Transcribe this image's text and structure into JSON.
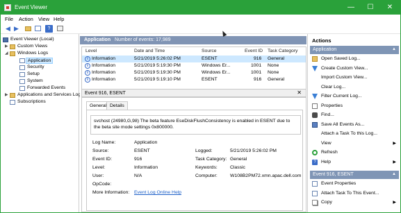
{
  "window": {
    "title": "Event Viewer",
    "controls": {
      "minimize": "—",
      "maximize": "☐",
      "close": "✕"
    }
  },
  "menu": [
    "File",
    "Action",
    "View",
    "Help"
  ],
  "tree": {
    "root": "Event Viewer (Local)",
    "custom_views": "Custom Views",
    "windows_logs": "Windows Logs",
    "logs": [
      "Application",
      "Security",
      "Setup",
      "System",
      "Forwarded Events"
    ],
    "apps_services": "Applications and Services Log",
    "subscriptions": "Subscriptions"
  },
  "log_header": {
    "name": "Application",
    "count_text": "Number of events: 17,989"
  },
  "grid": {
    "columns": [
      "Level",
      "Date and Time",
      "Source",
      "Event ID",
      "Task Category"
    ],
    "rows": [
      {
        "level": "Information",
        "date": "5/21/2019 5:26:02 PM",
        "source": "ESENT",
        "id": "916",
        "category": "General"
      },
      {
        "level": "Information",
        "date": "5/21/2019 5:19:30 PM",
        "source": "Windows Er...",
        "id": "1001",
        "category": "None"
      },
      {
        "level": "Information",
        "date": "5/21/2019 5:19:30 PM",
        "source": "Windows Er...",
        "id": "1001",
        "category": "None"
      },
      {
        "level": "Information",
        "date": "5/21/2019 5:19:10 PM",
        "source": "ESENT",
        "id": "916",
        "category": "General"
      }
    ]
  },
  "detail": {
    "header": "Event 916, ESENT",
    "close": "✕",
    "tabs": [
      "General",
      "Details"
    ],
    "description": "svchost (24980,G,98) The beta feature EseDiskFlushConsistency is enabled in ESENT due to the beta site mode settings 0x800000.",
    "fields": {
      "log_name_label": "Log Name:",
      "log_name": "Application",
      "source_label": "Source:",
      "source": "ESENT",
      "event_id_label": "Event ID:",
      "event_id": "916",
      "level_label": "Level:",
      "level": "Information",
      "user_label": "User:",
      "user": "N/A",
      "opcode_label": "OpCode:",
      "opcode": "",
      "more_info_label": "More Information:",
      "more_info_link": "Event Log Online Help",
      "logged_label": "Logged:",
      "logged": "5/21/2019 5:26:02 PM",
      "task_category_label": "Task Category:",
      "task_category": "General",
      "keywords_label": "Keywords:",
      "keywords": "Classic",
      "computer_label": "Computer:",
      "computer": "W108B2PM72.xmn.apac.dell.com"
    }
  },
  "actions": {
    "title": "Actions",
    "section1": "Application",
    "items1": [
      {
        "label": "Open Saved Log...",
        "icon": "folder",
        "arrow": ""
      },
      {
        "label": "Create Custom View...",
        "icon": "funnel",
        "arrow": ""
      },
      {
        "label": "Import Custom View...",
        "icon": "none",
        "arrow": ""
      },
      {
        "label": "Clear Log...",
        "icon": "none",
        "arrow": ""
      },
      {
        "label": "Filter Current Log...",
        "icon": "funnel",
        "arrow": ""
      },
      {
        "label": "Properties",
        "icon": "props",
        "arrow": ""
      },
      {
        "label": "Find...",
        "icon": "bino",
        "arrow": ""
      },
      {
        "label": "Save All Events As...",
        "icon": "save",
        "arrow": ""
      },
      {
        "label": "Attach a Task To this Log...",
        "icon": "none",
        "arrow": ""
      },
      {
        "label": "View",
        "icon": "none",
        "arrow": "▶"
      },
      {
        "label": "Refresh",
        "icon": "refresh",
        "arrow": ""
      },
      {
        "label": "Help",
        "icon": "help",
        "arrow": "▶"
      }
    ],
    "section2": "Event 916, ESENT",
    "items2": [
      {
        "label": "Event Properties",
        "icon": "ev",
        "arrow": ""
      },
      {
        "label": "Attach Task To This Event...",
        "icon": "task",
        "arrow": ""
      },
      {
        "label": "Copy",
        "icon": "copy",
        "arrow": "▶"
      }
    ],
    "section_arrow": "▲"
  }
}
